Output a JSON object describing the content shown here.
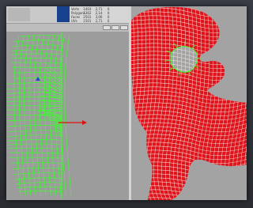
{
  "uv_editor": {
    "stats": [
      {
        "label": "Verts",
        "a": "1403",
        "b": "2,71",
        "c": "0"
      },
      {
        "label": "Polygons",
        "a": "1362",
        "b": "2,14",
        "c": "0"
      },
      {
        "label": "Faces",
        "a": "2501",
        "b": "3,06",
        "c": "0"
      },
      {
        "label": "UVs",
        "a": "1501",
        "b": "2,71",
        "c": "0"
      }
    ]
  },
  "colors": {
    "uv_wire": "#39ff2a",
    "mesh_fill": "#e0141c",
    "mesh_wire": "#f4e8e0",
    "axis_arrow": "#e01010",
    "background": "#9c9c9c"
  }
}
